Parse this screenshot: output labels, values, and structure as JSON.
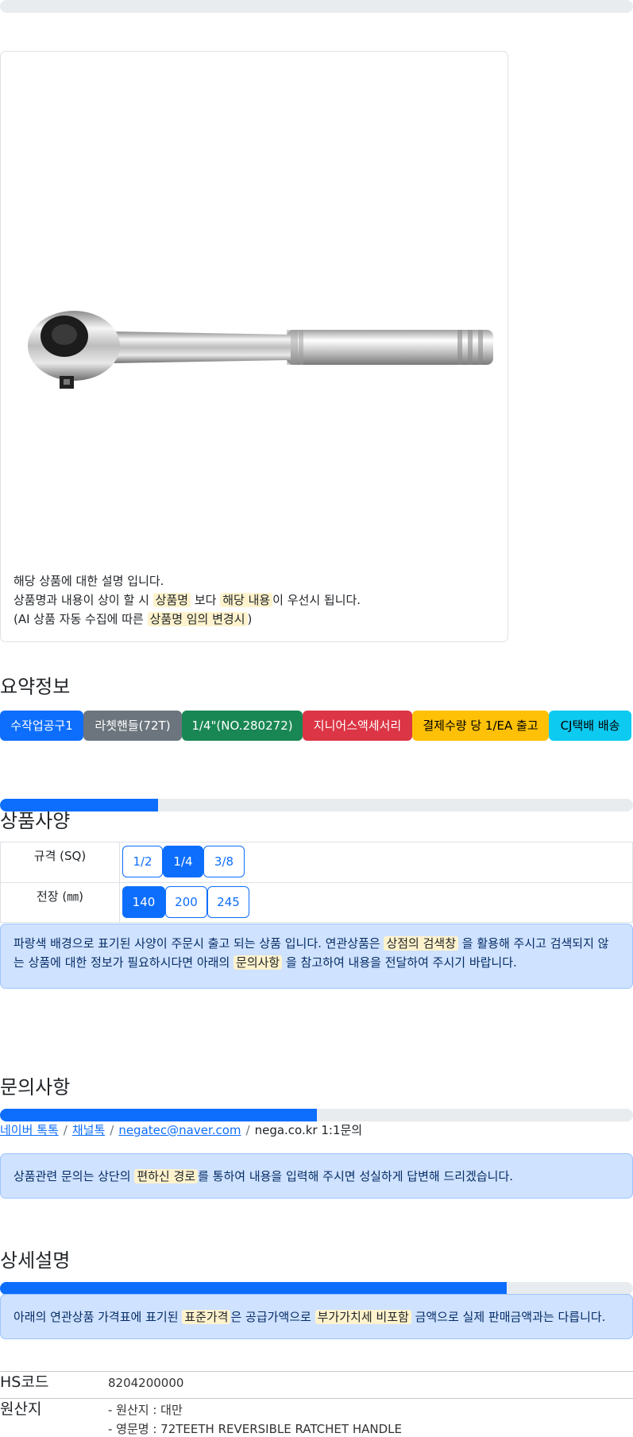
{
  "progress": {
    "top": 0,
    "spec": 0.25,
    "inquiry": 0.5,
    "detail": 0.8
  },
  "product_card": {
    "image_alt": "72TEETH REVERSIBLE RATCHET HANDLE",
    "line1": "해당 상품에 대한 설명 입니다.",
    "line2_a": "상품명과 내용이 상이 할 시 ",
    "line2_hl1": "상품명",
    "line2_b": " 보다 ",
    "line2_hl2": "해당 내용",
    "line2_c": "이 우선시 됩니다.",
    "line3_a": "(AI 상품 자동 수집에 따른 ",
    "line3_hl": "상품명 임의 변경시",
    "line3_b": ")"
  },
  "summary": {
    "title": "요약정보",
    "badges": [
      {
        "label": "수작업공구1",
        "color": "#0d6efd"
      },
      {
        "label": "라쳇핸들(72T)",
        "color": "#6c757d"
      },
      {
        "label": "1/4\"(NO.280272)",
        "color": "#198754"
      },
      {
        "label": "지니어스액세서리",
        "color": "#dc3545"
      },
      {
        "label": "결제수량 당 1/EA 출고",
        "color": "#ffc107"
      },
      {
        "label": "CJ택배 배송",
        "color": "#0dcaf0"
      }
    ]
  },
  "spec": {
    "title": "상품사양",
    "rows": [
      {
        "label": "규격 (SQ)",
        "options": [
          "1/2",
          "1/4",
          "3/8"
        ],
        "selected": "1/4"
      },
      {
        "label": "전장 (㎜)",
        "options": [
          "140",
          "200",
          "245"
        ],
        "selected": "140"
      }
    ],
    "notice_a": "파랑색 배경으로 표기된 사양이 주문시 출고 되는 상품 입니다. 연관상품은 ",
    "notice_hl1": "상점의 검색창",
    "notice_b": " 을 활용해 주시고 검색되지 않는 상품에 대한 정보가 필요하시다면 아래의 ",
    "notice_hl2": "문의사항",
    "notice_c": " 을 참고하여 내용을 전달하여 주시기 바랍니다."
  },
  "inquiry": {
    "title": "문의사항",
    "links": [
      "네이버 톡톡",
      "채널톡",
      "negatec@naver.com"
    ],
    "plain": "nega.co.kr 1:1문의",
    "separator": "/",
    "notice_a": "상품관련 문의는 상단의 ",
    "notice_hl": "편하신 경로",
    "notice_b": "를 통하여 내용을 입력해 주시면 성실하게 답변해 드리겠습니다."
  },
  "detail": {
    "title": "상세설명",
    "notice_a": "아래의 연관상품 가격표에 표기된 ",
    "notice_hl1": "표준가격",
    "notice_b": "은 공급가액으로 ",
    "notice_hl2": "부가가치세 비포함",
    "notice_c": " 금액으로 실제 판매금액과는 다릅니다."
  },
  "info": [
    {
      "key": "HS코드",
      "values": [
        "8204200000"
      ]
    },
    {
      "key": "원산지",
      "values": [
        "- 원산지 : 대만",
        "- 영문명 : 72TEETH REVERSIBLE RATCHET HANDLE"
      ]
    }
  ]
}
